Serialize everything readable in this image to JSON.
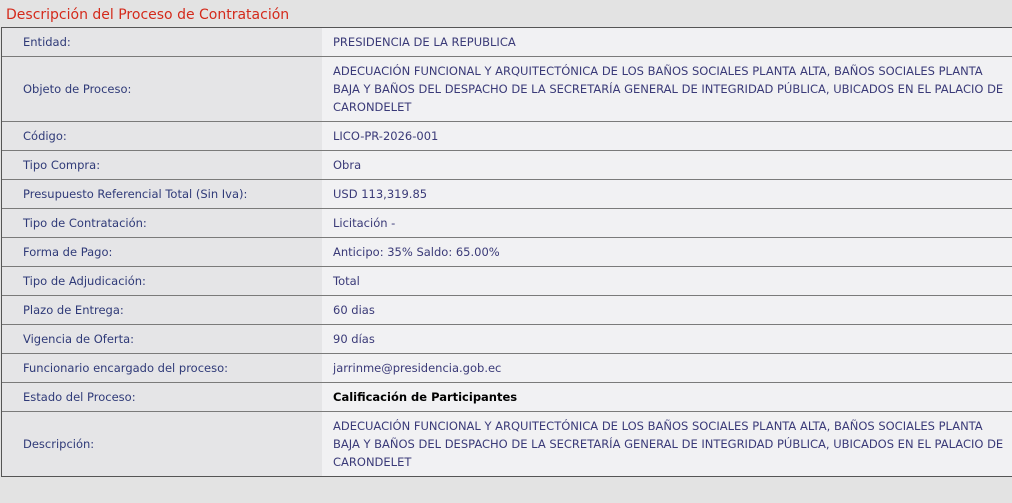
{
  "header": {
    "title": "Descripción del Proceso de Contratación"
  },
  "rows": [
    {
      "label": "Entidad:",
      "value": "PRESIDENCIA DE LA REPUBLICA"
    },
    {
      "label": "Objeto de Proceso:",
      "value": "ADECUACIÓN FUNCIONAL Y ARQUITECTÓNICA DE LOS BAÑOS SOCIALES PLANTA ALTA, BAÑOS SOCIALES PLANTA BAJA Y BAÑOS DEL DESPACHO DE LA SECRETARÍA GENERAL DE INTEGRIDAD PÚBLICA, UBICADOS EN EL PALACIO DE CARONDELET"
    },
    {
      "label": "Código:",
      "value": "LICO-PR-2026-001"
    },
    {
      "label": "Tipo Compra:",
      "value": "Obra"
    },
    {
      "label": "Presupuesto Referencial Total (Sin Iva):",
      "value": "USD 113,319.85"
    },
    {
      "label": "Tipo de Contratación:",
      "value": "Licitación -"
    },
    {
      "label": "Forma de Pago:",
      "value": "Anticipo: 35% Saldo: 65.00%"
    },
    {
      "label": "Tipo de Adjudicación:",
      "value": "Total"
    },
    {
      "label": "Plazo de Entrega:",
      "value": "60 dias"
    },
    {
      "label": "Vigencia de Oferta:",
      "value": "90 días"
    },
    {
      "label": "Funcionario encargado del proceso:",
      "value": "jarrinme@presidencia.gob.ec"
    },
    {
      "label": "Estado del Proceso:",
      "value": "Calificación de Participantes"
    },
    {
      "label": "Descripción:",
      "value": "ADECUACIÓN FUNCIONAL Y ARQUITECTÓNICA DE LOS BAÑOS SOCIALES PLANTA ALTA, BAÑOS SOCIALES PLANTA BAJA Y BAÑOS DEL DESPACHO DE LA SECRETARÍA GENERAL DE INTEGRIDAD PÚBLICA, UBICADOS EN EL PALACIO DE CARONDELET"
    }
  ]
}
